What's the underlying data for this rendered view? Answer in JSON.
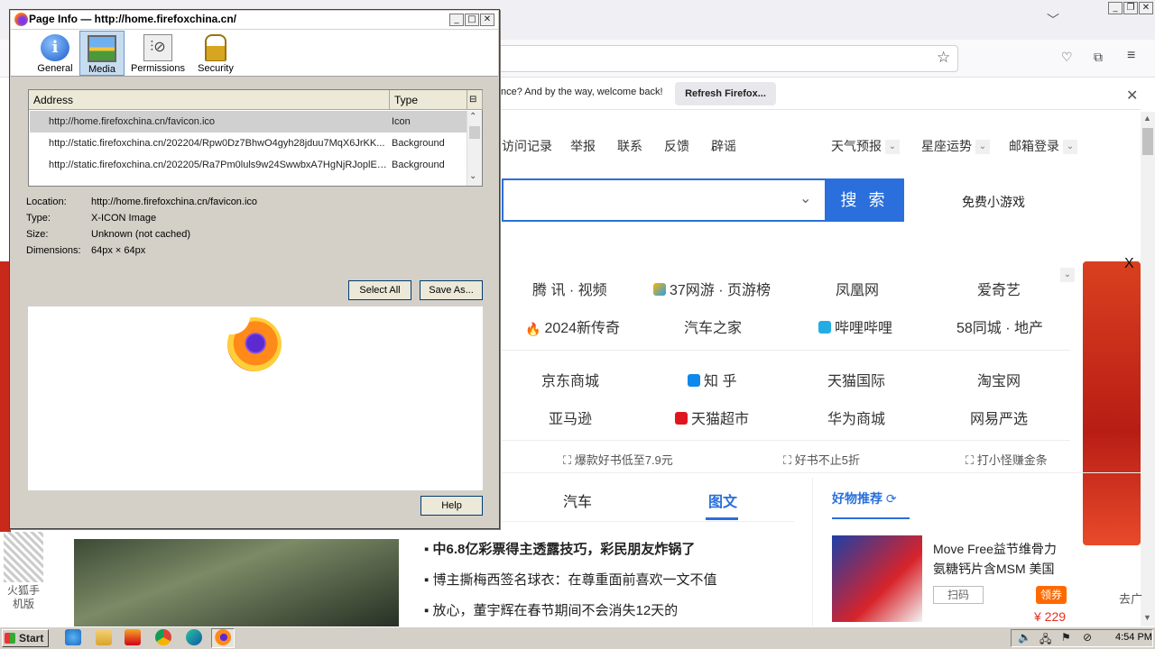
{
  "dialog": {
    "title": "Page Info — http://home.firefoxchina.cn/",
    "tabs": [
      {
        "label": "General",
        "icon": "info-icon"
      },
      {
        "label": "Media",
        "icon": "image-icon",
        "selected": true
      },
      {
        "label": "Permissions",
        "icon": "sliders-icon"
      },
      {
        "label": "Security",
        "icon": "lock-icon"
      }
    ],
    "table": {
      "headers": [
        "Address",
        "Type"
      ],
      "rows": [
        {
          "address": "http://home.firefoxchina.cn/favicon.ico",
          "type": "Icon",
          "selected": true
        },
        {
          "address": "http://static.firefoxchina.cn/202204/Rpw0Dz7BhwO4gyh28jduu7MqX6JrKK...",
          "type": "Background"
        },
        {
          "address": "http://static.firefoxchina.cn/202205/Ra7Pm0luls9w24SwwbxA7HgNjRJoplEL...",
          "type": "Background"
        }
      ]
    },
    "details": {
      "location_label": "Location:",
      "location": "http://home.firefoxchina.cn/favicon.ico",
      "type_label": "Type:",
      "type": "X-ICON Image",
      "size_label": "Size:",
      "size": "Unknown (not cached)",
      "dims_label": "Dimensions:",
      "dims": "64px × 64px"
    },
    "buttons": {
      "select_all": "Select All",
      "save_as": "Save As...",
      "help": "Help"
    }
  },
  "browser": {
    "notice_text": "nce? And by the way, welcome back!",
    "refresh_button": "Refresh Firefox...",
    "top_nav": [
      "访问记录",
      "举报",
      "联系",
      "反馈",
      "辟谣"
    ],
    "top_nav_right": [
      "天气预报",
      "星座运势",
      "邮箱登录"
    ],
    "search_button": "搜 索",
    "free_games": "免费小游戏",
    "sites_row1": [
      "腾 讯 · 视频",
      "37网游 · 页游榜",
      "凤凰网",
      "爱奇艺"
    ],
    "sites_row2": [
      "2024新传奇",
      "汽车之家",
      "哔哩哔哩",
      "58同城 · 地产"
    ],
    "sites_row3": [
      "京东商城",
      "知 乎",
      "天猫国际",
      "淘宝网"
    ],
    "sites_row4": [
      "亚马逊",
      "天猫超市",
      "华为商城",
      "网易严选"
    ],
    "promos": [
      "爆款好书低至7.9元",
      "好书不止5折",
      "打小怪赚金条"
    ],
    "tab_car": "汽车",
    "tab_pic": "图文",
    "good_title": "好物推荐",
    "news": [
      "▪ 中6.8亿彩票得主透露技巧，彩民朋友炸锅了",
      "▪ 博主撕梅西签名球衣：在尊重面前喜欢一文不值",
      "▪ 放心，董宇辉在春节期间不会消失12天的"
    ],
    "product_text": "Move Free益节维骨力氨糖钙片含MSM 美国",
    "product_tag": "扫码",
    "product_badge": "领券",
    "product_price": "¥ 229",
    "qr_label": "火狐手机版",
    "hide_label": "去广",
    "ad_close": "X"
  },
  "taskbar": {
    "start": "Start",
    "clock": "4:54 PM"
  },
  "colors": {
    "accent": "#2a6fdb",
    "selection": "#c8dcf0",
    "dialog_bg": "#d4d0c8"
  }
}
